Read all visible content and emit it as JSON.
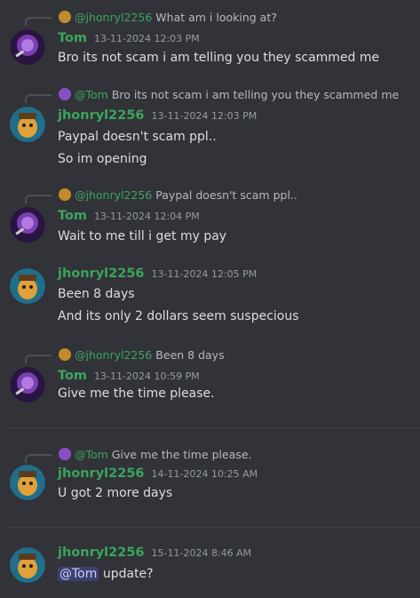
{
  "colors": {
    "background": "#313338",
    "tom_name": "#3ba55d",
    "jhonryl_name": "#3ba55d",
    "text": "#dbdee1",
    "muted": "#949ba4",
    "mention_bg": "#3c4270"
  },
  "messages": [
    {
      "reply": {
        "author": "@jhonryl2256",
        "text": "What am i looking at?",
        "author_color": "#3ba55d"
      },
      "author": "Tom",
      "author_color": "#3ba55d",
      "timestamp": "13-11-2024 12:03 PM",
      "avatar": "tom",
      "lines": [
        "Bro its not scam i am telling you they scammed me"
      ]
    },
    {
      "reply": {
        "author": "@Tom",
        "text": "Bro its not scam i am telling you they scammed me",
        "author_color": "#3ba55d"
      },
      "author": "jhonryl2256",
      "author_color": "#3ba55d",
      "timestamp": "13-11-2024 12:03 PM",
      "avatar": "jhonryl",
      "lines": [
        "Paypal doesn't scam ppl..",
        "So im opening"
      ]
    },
    {
      "reply": {
        "author": "@jhonryl2256",
        "text": "Paypal doesn't scam ppl..",
        "author_color": "#3ba55d"
      },
      "author": "Tom",
      "author_color": "#3ba55d",
      "timestamp": "13-11-2024 12:04 PM",
      "avatar": "tom",
      "lines": [
        "Wait to me till i get my pay"
      ]
    },
    {
      "author": "jhonryl2256",
      "author_color": "#3ba55d",
      "timestamp": "13-11-2024 12:05 PM",
      "avatar": "jhonryl",
      "lines": [
        "Been 8 days",
        "And its only 2 dollars seem suspecious"
      ]
    },
    {
      "reply": {
        "author": "@jhonryl2256",
        "text": "Been 8 days",
        "author_color": "#3ba55d"
      },
      "author": "Tom",
      "author_color": "#3ba55d",
      "timestamp": "13-11-2024 10:59 PM",
      "avatar": "tom",
      "lines": [
        "Give me the time please."
      ]
    },
    {
      "reply": {
        "author": "@Tom",
        "text": "Give me the time please.",
        "author_color": "#3ba55d"
      },
      "author": "jhonryl2256",
      "author_color": "#3ba55d",
      "timestamp": "14-11-2024 10:25 AM",
      "avatar": "jhonryl",
      "lines": [
        "U got 2 more days"
      ]
    },
    {
      "author": "jhonryl2256",
      "author_color": "#3ba55d",
      "timestamp": "15-11-2024 8:46 AM",
      "avatar": "jhonryl",
      "mention": "@Tom",
      "lines": [
        "update?"
      ]
    }
  ]
}
